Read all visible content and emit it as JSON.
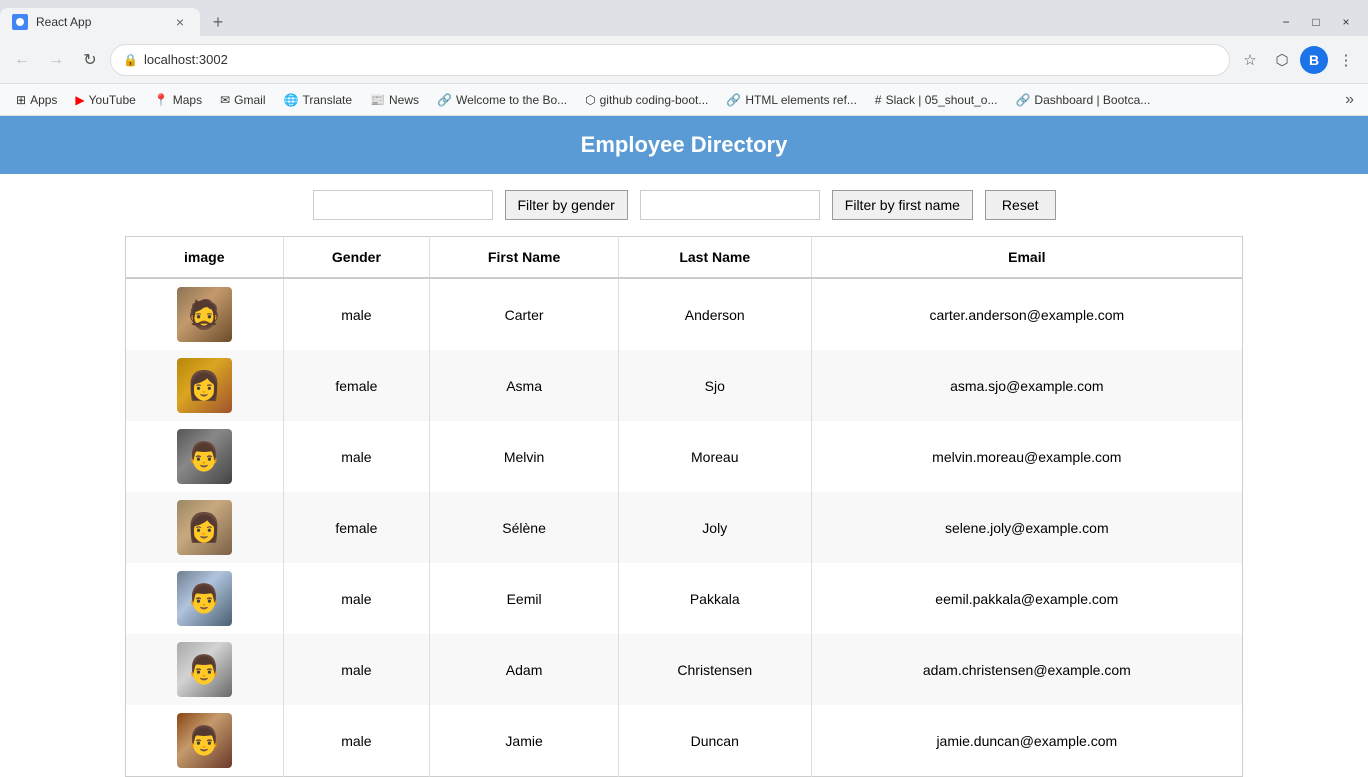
{
  "browser": {
    "tab_title": "React App",
    "tab_close": "×",
    "new_tab": "+",
    "url": "localhost:3002",
    "win_minimize": "−",
    "win_maximize": "□",
    "win_close": "×",
    "back_arrow": "←",
    "forward_arrow": "→",
    "reload": "↻",
    "star_icon": "☆",
    "extension_icon": "⬡",
    "more_icon": "⋮",
    "profile_letter": "B"
  },
  "bookmarks": [
    {
      "label": "Apps",
      "icon": "grid"
    },
    {
      "label": "YouTube",
      "icon": "yt"
    },
    {
      "label": "Maps",
      "icon": "maps"
    },
    {
      "label": "Gmail",
      "icon": "gmail"
    },
    {
      "label": "Translate",
      "icon": "translate"
    },
    {
      "label": "News",
      "icon": "news"
    },
    {
      "label": "Welcome to the Bo...",
      "icon": "link"
    },
    {
      "label": "github coding-boot...",
      "icon": "gh"
    },
    {
      "label": "HTML elements ref...",
      "icon": "link"
    },
    {
      "label": "Slack | 05_shout_o...",
      "icon": "slack"
    },
    {
      "label": "Dashboard | Bootca...",
      "icon": "link"
    }
  ],
  "app": {
    "title": "Employee Directory",
    "header_bg": "#5b9bd5"
  },
  "filters": {
    "gender_placeholder": "",
    "gender_btn": "Filter by gender",
    "name_placeholder": "",
    "name_btn": "Filter by first name",
    "reset_btn": "Reset"
  },
  "table": {
    "columns": [
      "image",
      "Gender",
      "First Name",
      "Last Name",
      "Email"
    ],
    "rows": [
      {
        "gender": "male",
        "first_name": "Carter",
        "last_name": "Anderson",
        "email": "carter.anderson@example.com",
        "avatar_class": "av1",
        "emoji": "🧑"
      },
      {
        "gender": "female",
        "first_name": "Asma",
        "last_name": "Sjo",
        "email": "asma.sjo@example.com",
        "avatar_class": "av2",
        "emoji": "👩"
      },
      {
        "gender": "male",
        "first_name": "Melvin",
        "last_name": "Moreau",
        "email": "melvin.moreau@example.com",
        "avatar_class": "av3",
        "emoji": "👨"
      },
      {
        "gender": "female",
        "first_name": "Sélène",
        "last_name": "Joly",
        "email": "selene.joly@example.com",
        "avatar_class": "av4",
        "emoji": "👩"
      },
      {
        "gender": "male",
        "first_name": "Eemil",
        "last_name": "Pakkala",
        "email": "eemil.pakkala@example.com",
        "avatar_class": "av5",
        "emoji": "👨"
      },
      {
        "gender": "male",
        "first_name": "Adam",
        "last_name": "Christensen",
        "email": "adam.christensen@example.com",
        "avatar_class": "av6",
        "emoji": "👨"
      },
      {
        "gender": "male",
        "first_name": "Jamie",
        "last_name": "Duncan",
        "email": "jamie.duncan@example.com",
        "avatar_class": "av7",
        "emoji": "👨"
      }
    ]
  }
}
